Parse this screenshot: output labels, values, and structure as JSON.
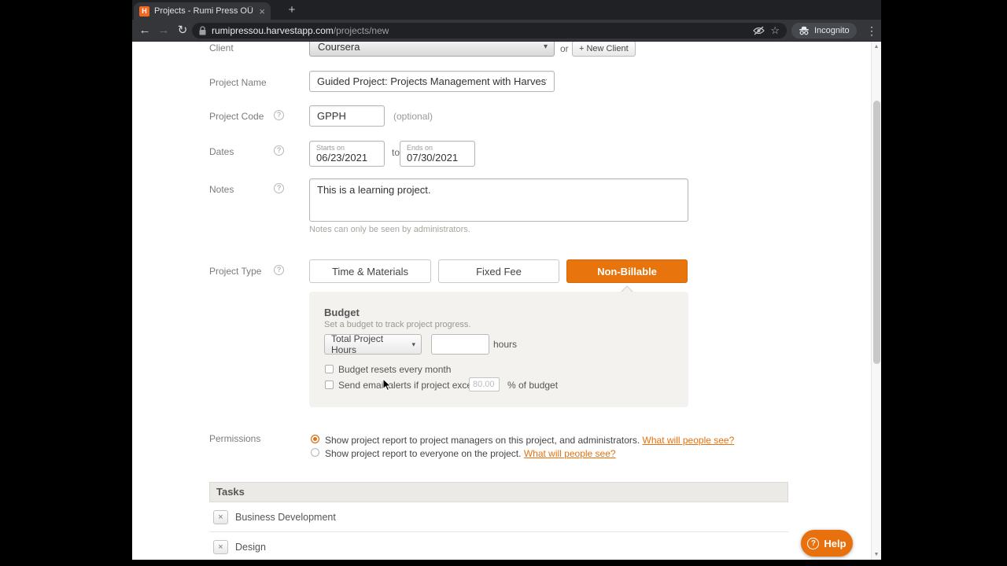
{
  "browser": {
    "tab_title": "Projects - Rumi Press OÜ",
    "favicon_letter": "H",
    "url_domain": "rumipressou.harvestapp.com",
    "url_path": "/projects/new",
    "incognito_label": "Incognito"
  },
  "icons": {
    "close_tab": "×",
    "new_tab": "+",
    "back": "←",
    "forward": "→",
    "reload": "↻",
    "star": "☆",
    "menu": "⋮",
    "scroll_up": "▲",
    "scroll_down": "▼",
    "select_arrow": "▾",
    "help": "?",
    "remove": "×"
  },
  "form": {
    "client": {
      "label": "Client",
      "value": "Coursera",
      "or_text": "or",
      "new_client_button": "+ New Client"
    },
    "project_name": {
      "label": "Project Name",
      "value": "Guided Project: Projects Management with Harvest"
    },
    "project_code": {
      "label": "Project Code",
      "value": "GPPH",
      "optional_text": "(optional)"
    },
    "dates": {
      "label": "Dates",
      "starts_on_label": "Starts on",
      "starts_on_value": "06/23/2021",
      "to_text": "to",
      "ends_on_label": "Ends on",
      "ends_on_value": "07/30/2021"
    },
    "notes": {
      "label": "Notes",
      "value": "This is a learning project.",
      "hint": "Notes can only be seen by administrators."
    },
    "project_type": {
      "label": "Project Type",
      "options": [
        "Time & Materials",
        "Fixed Fee",
        "Non-Billable"
      ],
      "selected": "Non-Billable"
    },
    "budget": {
      "title": "Budget",
      "subtitle": "Set a budget to track project progress.",
      "metric_select": "Total Project Hours",
      "hours_suffix": "hours",
      "reset_checkbox_label": "Budget resets every month",
      "alert_checkbox_label": "Send email alerts if project exceeds",
      "alert_percent_placeholder": "80.00",
      "alert_suffix": "% of budget"
    },
    "permissions": {
      "label": "Permissions",
      "option1": "Show project report to project managers on this project, and administrators.",
      "option1_link": "What will people see?",
      "option2": "Show project report to everyone on the project.",
      "option2_link": "What will people see?"
    },
    "tasks": {
      "header": "Tasks",
      "items": [
        "Business Development",
        "Design"
      ]
    }
  },
  "help_button_label": "Help",
  "colors": {
    "accent": "#e8740e",
    "link": "#e8710d"
  }
}
